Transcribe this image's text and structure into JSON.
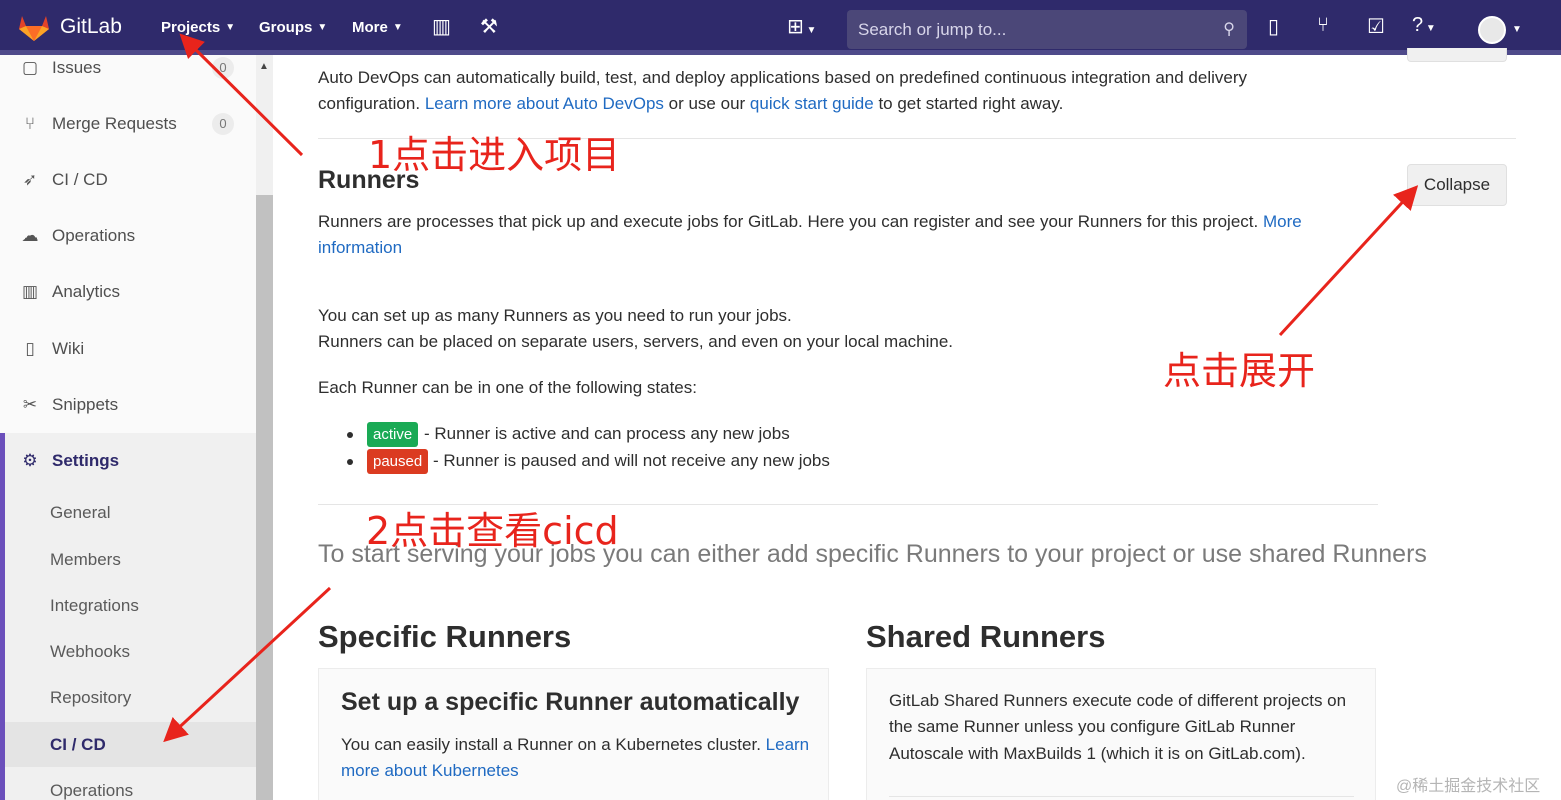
{
  "topbar": {
    "brand": "GitLab",
    "nav": [
      {
        "label": "Projects"
      },
      {
        "label": "Groups"
      },
      {
        "label": "More"
      }
    ],
    "search_placeholder": "Search or jump to...",
    "icons": [
      "chart-bar-icon",
      "wrench-icon",
      "plus-square-icon",
      "todo-icon",
      "merge-request-icon",
      "issues-check-icon",
      "help-icon",
      "avatar"
    ]
  },
  "sidebar": {
    "items": [
      {
        "label": "Issues",
        "count": "0",
        "icon": "issues-icon"
      },
      {
        "label": "Merge Requests",
        "count": "0",
        "icon": "merge-request-icon"
      },
      {
        "label": "CI / CD",
        "icon": "rocket-icon"
      },
      {
        "label": "Operations",
        "icon": "cloud-gear-icon"
      },
      {
        "label": "Analytics",
        "icon": "chart-icon"
      },
      {
        "label": "Wiki",
        "icon": "book-icon"
      },
      {
        "label": "Snippets",
        "icon": "scissors-icon"
      },
      {
        "label": "Settings",
        "icon": "gear-icon"
      }
    ],
    "settings_sub": [
      "General",
      "Members",
      "Integrations",
      "Webhooks",
      "Repository",
      "CI / CD",
      "Operations"
    ]
  },
  "autodevops": {
    "text_1": "Auto DevOps can automatically build, test, and deploy applications based on predefined continuous integration and delivery",
    "text_2a": "configuration.",
    "link_1": "Learn more about Auto DevOps",
    "text_2b": "or use our",
    "link_2": "quick start guide",
    "text_2c": "to get started right away."
  },
  "runners": {
    "title": "Runners",
    "collapse_label": "Collapse",
    "desc": "Runners are processes that pick up and execute jobs for GitLab. Here you can register and see your Runners for this project.",
    "desc_link_1": "More",
    "desc_link_2": "information",
    "line_1": "You can set up as many Runners as you need to run your jobs.",
    "line_2": "Runners can be placed on separate users, servers, and even on your local machine.",
    "states_intro": "Each Runner can be in one of the following states:",
    "states": [
      {
        "badge": "active",
        "text": "- Runner is active and can process any new jobs",
        "color": "#1aaa55"
      },
      {
        "badge": "paused",
        "text": "- Runner is paused and will not receive any new jobs",
        "color": "#db3b21"
      }
    ],
    "lead": "To start serving your jobs you can either add specific Runners to your project or use shared Runners"
  },
  "specific": {
    "title": "Specific Runners",
    "panel_title": "Set up a specific Runner automatically",
    "panel_text": "You can easily install a Runner on a Kubernetes cluster.",
    "panel_link_1": "Learn",
    "panel_link_2": "more about Kubernetes"
  },
  "shared": {
    "title": "Shared Runners",
    "text_1": "GitLab Shared Runners execute code of different projects on",
    "text_2": "the same Runner unless you configure GitLab Runner",
    "text_3": "Autoscale with MaxBuilds 1 (which it is on GitLab.com)."
  },
  "annotations": {
    "a1": "1点击进入项目",
    "a2": "点击展开",
    "a3": "2点击查看cicd",
    "watermark": "@稀土掘金技术社区"
  }
}
